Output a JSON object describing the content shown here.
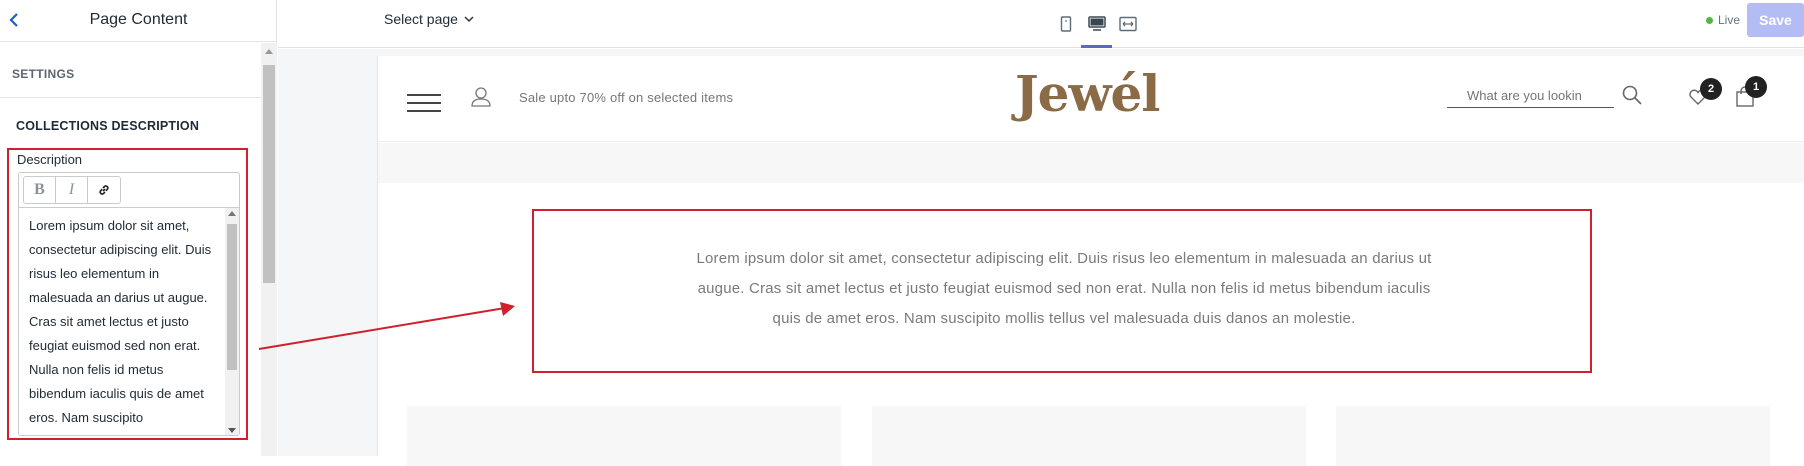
{
  "sidebar": {
    "title": "Page Content",
    "settings_heading": "SETTINGS",
    "section_heading": "COLLECTIONS DESCRIPTION",
    "description_label": "Description",
    "toolbar": {
      "bold": "B",
      "italic": "I",
      "link_icon": "link-icon"
    },
    "description_text": "Lorem ipsum dolor sit amet, consectetur adipiscing elit. Duis risus leo elementum in malesuada an darius ut augue. Cras sit amet lectus et justo feugiat euismod sed non erat. Nulla non felis id metus bibendum iaculis quis de amet eros. Nam suscipito"
  },
  "topbar": {
    "select_page": "Select page",
    "devices": [
      "mobile-icon",
      "desktop-icon",
      "full-width-icon"
    ],
    "active_device": "desktop",
    "status": "Live",
    "save_label": "Save"
  },
  "preview": {
    "promo_text": "Sale upto 70% off on selected items",
    "logo": "Jewél",
    "search_placeholder": "What are you lookin",
    "wishlist_count": "2",
    "cart_count": "1",
    "description": "Lorem ipsum dolor sit amet, consectetur adipiscing elit. Duis risus leo elementum in malesuada an darius ut augue. Cras sit amet lectus et justo feugiat euismod sed non erat. Nulla non felis id metus bibendum iaculis quis de amet eros. Nam suscipito mollis tellus vel malesuada duis danos an molestie."
  },
  "colors": {
    "accent": "#5c6ac4",
    "save_disabled": "#b3bcf5",
    "highlight": "#d0202d",
    "logo": "#8a6b45",
    "live": "#50b83c"
  }
}
